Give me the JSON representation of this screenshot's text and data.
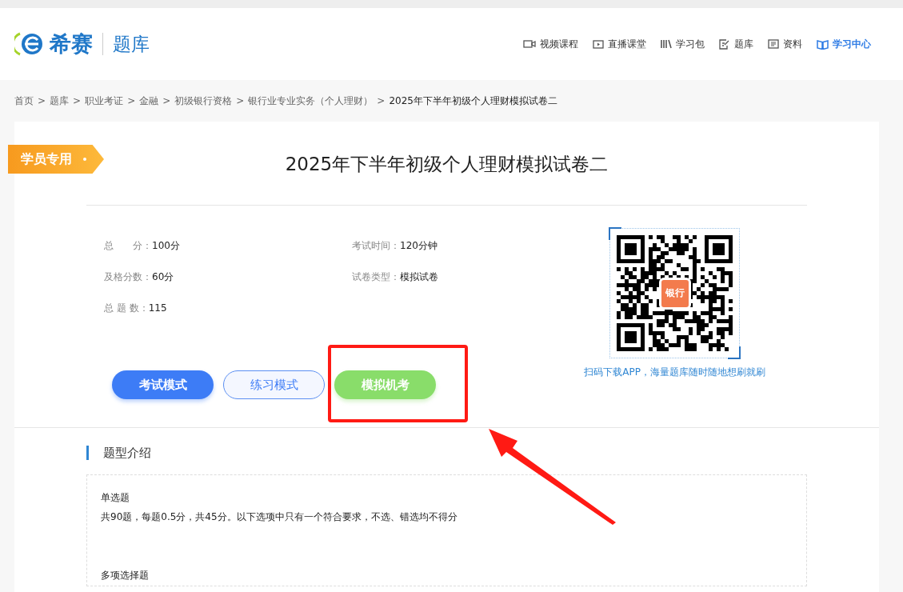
{
  "header": {
    "brand": "希赛",
    "section": "题库",
    "nav": [
      {
        "label": "视频课程",
        "selected": false
      },
      {
        "label": "直播课堂",
        "selected": false
      },
      {
        "label": "学习包",
        "selected": false
      },
      {
        "label": "题库",
        "selected": false
      },
      {
        "label": "资料",
        "selected": false
      },
      {
        "label": "学习中心",
        "selected": true
      }
    ]
  },
  "breadcrumb": [
    {
      "text": "首页"
    },
    {
      "sep": ">",
      "text": "题库"
    },
    {
      "sep": ">",
      "text": "职业考证"
    },
    {
      "sep": ">",
      "text": "金融"
    },
    {
      "sep": ">",
      "text": "初级银行资格"
    },
    {
      "sep": ">",
      "text": "银行业专业实务（个人理财）"
    },
    {
      "sep": ">",
      "text": "2025年下半年初级个人理财模拟试卷二"
    }
  ],
  "paper": {
    "ribbon": "学员专用",
    "title": "2025年下半年初级个人理财模拟试卷二",
    "info": [
      {
        "label": "总　　分：",
        "value": "100分"
      },
      {
        "label": "考试时间：",
        "value": "120分钟"
      },
      {
        "label": "及格分数：",
        "value": "60分"
      },
      {
        "label": "试卷类型：",
        "value": "模拟试卷"
      },
      {
        "label": "总 题 数：",
        "value": "115"
      }
    ],
    "modes": [
      {
        "label": "考试模式",
        "kind": "primary"
      },
      {
        "label": "练习模式",
        "kind": "outline"
      },
      {
        "label": "模拟机考",
        "kind": "green"
      }
    ],
    "qr": {
      "badge": "银行",
      "caption": "扫码下载APP，海量题库随时随地想刷就刷"
    }
  },
  "intro": {
    "heading": "题型介绍",
    "types": [
      {
        "name": "单选题",
        "desc": "共90题，每题0.5分，共45分。以下选项中只有一个符合要求，不选、错选均不得分"
      },
      {
        "name": "多项选择题"
      }
    ]
  }
}
